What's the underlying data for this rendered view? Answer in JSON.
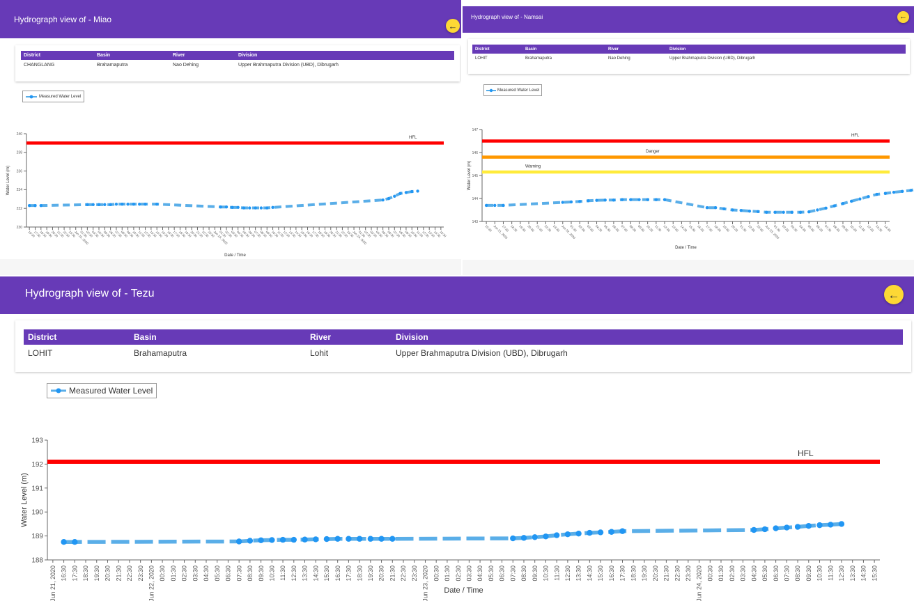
{
  "colors": {
    "header": "#673ab7",
    "back_button": "#fdd835",
    "hfl": "#ff0000",
    "danger": "#ff9800",
    "warning": "#ffeb3b",
    "series": "#5aaee8",
    "marker": "#2196f3"
  },
  "icons": {
    "back": "arrow-left-icon"
  },
  "table_headers": {
    "district": "District",
    "basin": "Basin",
    "river": "River",
    "division": "Division"
  },
  "stations": [
    {
      "title": "Hydrograph view of - Miao",
      "district": "CHANGLANG",
      "basin": "Brahamaputra",
      "river": "Nao Dehing",
      "division": "Upper Brahmaputra Division (UBD), Dibrugarh",
      "legend": "Measured Water Level"
    },
    {
      "title": "Hydrograph view of - Namsai",
      "district": "LOHIT",
      "basin": "Brahamaputra",
      "river": "Nao Dehing",
      "division": "Upper Brahmaputra Division (UBD), Dibrugarh",
      "legend": "Measured Water Level"
    },
    {
      "title": "Hydrograph view of - Tezu",
      "district": "LOHIT",
      "basin": "Brahamaputra",
      "river": "Lohit",
      "division": "Upper Brahmaputra Division (UBD), Dibrugarh",
      "legend": "Measured Water Level"
    }
  ],
  "chart_data": [
    {
      "type": "line",
      "xlabel": "Date / Time",
      "ylabel": "Water Level (m)",
      "ylim": [
        230,
        240
      ],
      "yticks": [
        230,
        232,
        234,
        236,
        238,
        240
      ],
      "xticks": [
        "16:30",
        "17:30",
        "18:30",
        "19:30",
        "20:30",
        "21:30",
        "22:30",
        "23:30",
        "Jun 22, 2020",
        "01:30",
        "02:30",
        "03:30",
        "04:30",
        "05:30",
        "06:30",
        "07:30",
        "08:30",
        "09:30",
        "10:30",
        "11:30",
        "12:30",
        "13:30",
        "14:30",
        "15:30",
        "16:30",
        "17:30",
        "18:30",
        "19:30",
        "20:30",
        "21:30",
        "22:30",
        "23:30",
        "Jun 23, 2020",
        "01:30",
        "02:30",
        "03:30",
        "04:30",
        "05:30",
        "06:30",
        "07:30",
        "08:30",
        "09:30",
        "10:30",
        "11:30",
        "12:30",
        "13:30",
        "14:30",
        "15:30",
        "16:30",
        "17:30",
        "18:30",
        "19:30",
        "20:30",
        "21:30",
        "22:30",
        "23:30",
        "Jun 24, 2020",
        "01:30",
        "02:30",
        "03:30",
        "04:30",
        "05:30",
        "06:30",
        "07:30",
        "08:30",
        "09:30",
        "10:30",
        "11:30",
        "12:30",
        "13:30",
        "14:30",
        "15:30"
      ],
      "series": [
        {
          "name": "Measured Water Level",
          "points": [
            [
              0,
              232.3
            ],
            [
              1,
              232.3
            ],
            [
              2,
              232.3
            ],
            [
              10,
              232.4
            ],
            [
              11,
              232.4
            ],
            [
              12,
              232.4
            ],
            [
              13,
              232.4
            ],
            [
              14,
              232.4
            ],
            [
              15,
              232.45
            ],
            [
              16,
              232.45
            ],
            [
              17,
              232.45
            ],
            [
              18,
              232.45
            ],
            [
              19,
              232.45
            ],
            [
              20,
              232.45
            ],
            [
              22,
              232.45
            ],
            [
              33,
              232.15
            ],
            [
              34,
              232.15
            ],
            [
              35,
              232.1
            ],
            [
              36,
              232.1
            ],
            [
              37,
              232.05
            ],
            [
              38,
              232.05
            ],
            [
              39,
              232.05
            ],
            [
              40,
              232.05
            ],
            [
              41,
              232.05
            ],
            [
              42,
              232.1
            ],
            [
              61,
              232.9
            ],
            [
              62,
              233.05
            ],
            [
              63,
              233.3
            ],
            [
              64,
              233.6
            ],
            [
              65,
              233.7
            ],
            [
              66,
              233.8
            ],
            [
              67,
              233.85
            ]
          ]
        }
      ],
      "reference_lines": [
        {
          "label": "HFL",
          "value": 239.0,
          "color": "#ff0000"
        }
      ]
    },
    {
      "type": "line",
      "xlabel": "Date / Time",
      "ylabel": "Water Level (m)",
      "ylim": [
        143,
        147
      ],
      "yticks": [
        143,
        144,
        145,
        146,
        147
      ],
      "xticks": [
        "15:30",
        "Jun 21, 2020",
        "17:30",
        "18:30",
        "19:30",
        "20:30",
        "21:30",
        "22:30",
        "23:30",
        "Jun 22, 2020",
        "01:30",
        "02:30",
        "03:30",
        "04:30",
        "05:30",
        "06:30",
        "07:30",
        "08:30",
        "09:30",
        "10:30",
        "11:30",
        "12:30",
        "13:30",
        "14:30",
        "15:30",
        "16:30",
        "17:30",
        "18:30",
        "19:30",
        "20:30",
        "21:30",
        "22:30",
        "23:30",
        "Jun 23, 2020",
        "01:30",
        "02:30",
        "03:30",
        "04:30",
        "05:30",
        "06:30",
        "07:30",
        "08:30",
        "09:30",
        "10:30",
        "11:30",
        "12:30",
        "13:30",
        "14:30"
      ],
      "series": [
        {
          "name": "Measured Water Level",
          "points": [
            [
              0,
              143.7
            ],
            [
              1,
              143.7
            ],
            [
              2,
              143.7
            ],
            [
              9,
              143.83
            ],
            [
              10,
              143.85
            ],
            [
              11,
              143.87
            ],
            [
              12,
              143.9
            ],
            [
              13,
              143.92
            ],
            [
              14,
              143.93
            ],
            [
              15,
              143.93
            ],
            [
              16,
              143.95
            ],
            [
              17,
              143.95
            ],
            [
              18,
              143.95
            ],
            [
              19,
              143.95
            ],
            [
              20,
              143.95
            ],
            [
              21,
              143.95
            ],
            [
              26,
              143.6
            ],
            [
              27,
              143.6
            ],
            [
              28,
              143.55
            ],
            [
              29,
              143.5
            ],
            [
              30,
              143.48
            ],
            [
              31,
              143.45
            ],
            [
              32,
              143.43
            ],
            [
              33,
              143.4
            ],
            [
              34,
              143.4
            ],
            [
              35,
              143.4
            ],
            [
              36,
              143.4
            ],
            [
              37,
              143.4
            ],
            [
              38,
              143.42
            ],
            [
              39,
              143.5
            ],
            [
              40,
              143.58
            ],
            [
              41,
              143.68
            ],
            [
              42,
              143.78
            ],
            [
              43,
              143.88
            ],
            [
              44,
              143.98
            ],
            [
              45,
              144.08
            ],
            [
              46,
              144.18
            ],
            [
              47,
              144.22
            ],
            [
              48,
              144.27
            ],
            [
              49,
              144.31
            ],
            [
              50,
              144.35
            ],
            [
              51,
              144.45
            ],
            [
              52,
              144.5
            ]
          ]
        }
      ],
      "reference_lines": [
        {
          "label": "HFL",
          "value": 146.5,
          "color": "#ff0000"
        },
        {
          "label": "Danger",
          "value": 145.8,
          "color": "#ff9800"
        },
        {
          "label": "Warning",
          "value": 145.15,
          "color": "#ffeb3b"
        }
      ]
    },
    {
      "type": "line",
      "xlabel": "Date / Time",
      "ylabel": "Water Level (m)",
      "ylim": [
        188,
        193
      ],
      "yticks": [
        188,
        189,
        190,
        191,
        192,
        193
      ],
      "xticks": [
        "Jun 21, 2020",
        "16:30",
        "17:30",
        "18:30",
        "19:30",
        "20:30",
        "21:30",
        "22:30",
        "23:30",
        "Jun 22, 2020",
        "00:30",
        "01:30",
        "02:30",
        "03:30",
        "04:30",
        "05:30",
        "06:30",
        "07:30",
        "08:30",
        "09:30",
        "10:30",
        "11:30",
        "12:30",
        "13:30",
        "14:30",
        "15:30",
        "16:30",
        "17:30",
        "18:30",
        "19:30",
        "20:30",
        "21:30",
        "22:30",
        "23:30",
        "Jun 23, 2020",
        "00:30",
        "01:30",
        "02:30",
        "03:30",
        "04:30",
        "05:30",
        "06:30",
        "07:30",
        "08:30",
        "09:30",
        "10:30",
        "11:30",
        "12:30",
        "13:30",
        "14:30",
        "15:30",
        "16:30",
        "17:30",
        "18:30",
        "19:30",
        "20:30",
        "21:30",
        "22:30",
        "23:30",
        "Jun 24, 2020",
        "00:30",
        "01:30",
        "02:30",
        "03:30",
        "04:30",
        "05:30",
        "06:30",
        "07:30",
        "08:30",
        "09:30",
        "10:30",
        "11:30",
        "12:30",
        "13:30",
        "14:30",
        "15:30"
      ],
      "series": [
        {
          "name": "Measured Water Level",
          "points": [
            [
              1,
              188.75
            ],
            [
              2,
              188.75
            ],
            [
              17,
              188.77
            ],
            [
              18,
              188.8
            ],
            [
              19,
              188.82
            ],
            [
              20,
              188.83
            ],
            [
              21,
              188.84
            ],
            [
              22,
              188.84
            ],
            [
              23,
              188.85
            ],
            [
              24,
              188.86
            ],
            [
              25,
              188.87
            ],
            [
              26,
              188.88
            ],
            [
              27,
              188.88
            ],
            [
              28,
              188.88
            ],
            [
              29,
              188.88
            ],
            [
              30,
              188.88
            ],
            [
              31,
              188.88
            ],
            [
              42,
              188.9
            ],
            [
              43,
              188.92
            ],
            [
              44,
              188.95
            ],
            [
              45,
              188.98
            ],
            [
              46,
              189.03
            ],
            [
              47,
              189.07
            ],
            [
              48,
              189.1
            ],
            [
              49,
              189.13
            ],
            [
              50,
              189.15
            ],
            [
              51,
              189.17
            ],
            [
              52,
              189.2
            ],
            [
              64,
              189.25
            ],
            [
              65,
              189.28
            ],
            [
              66,
              189.32
            ],
            [
              67,
              189.35
            ],
            [
              68,
              189.38
            ],
            [
              69,
              189.42
            ],
            [
              70,
              189.45
            ],
            [
              71,
              189.47
            ],
            [
              72,
              189.5
            ]
          ]
        }
      ],
      "reference_lines": [
        {
          "label": "HFL",
          "value": 192.1,
          "color": "#ff0000"
        }
      ]
    }
  ]
}
